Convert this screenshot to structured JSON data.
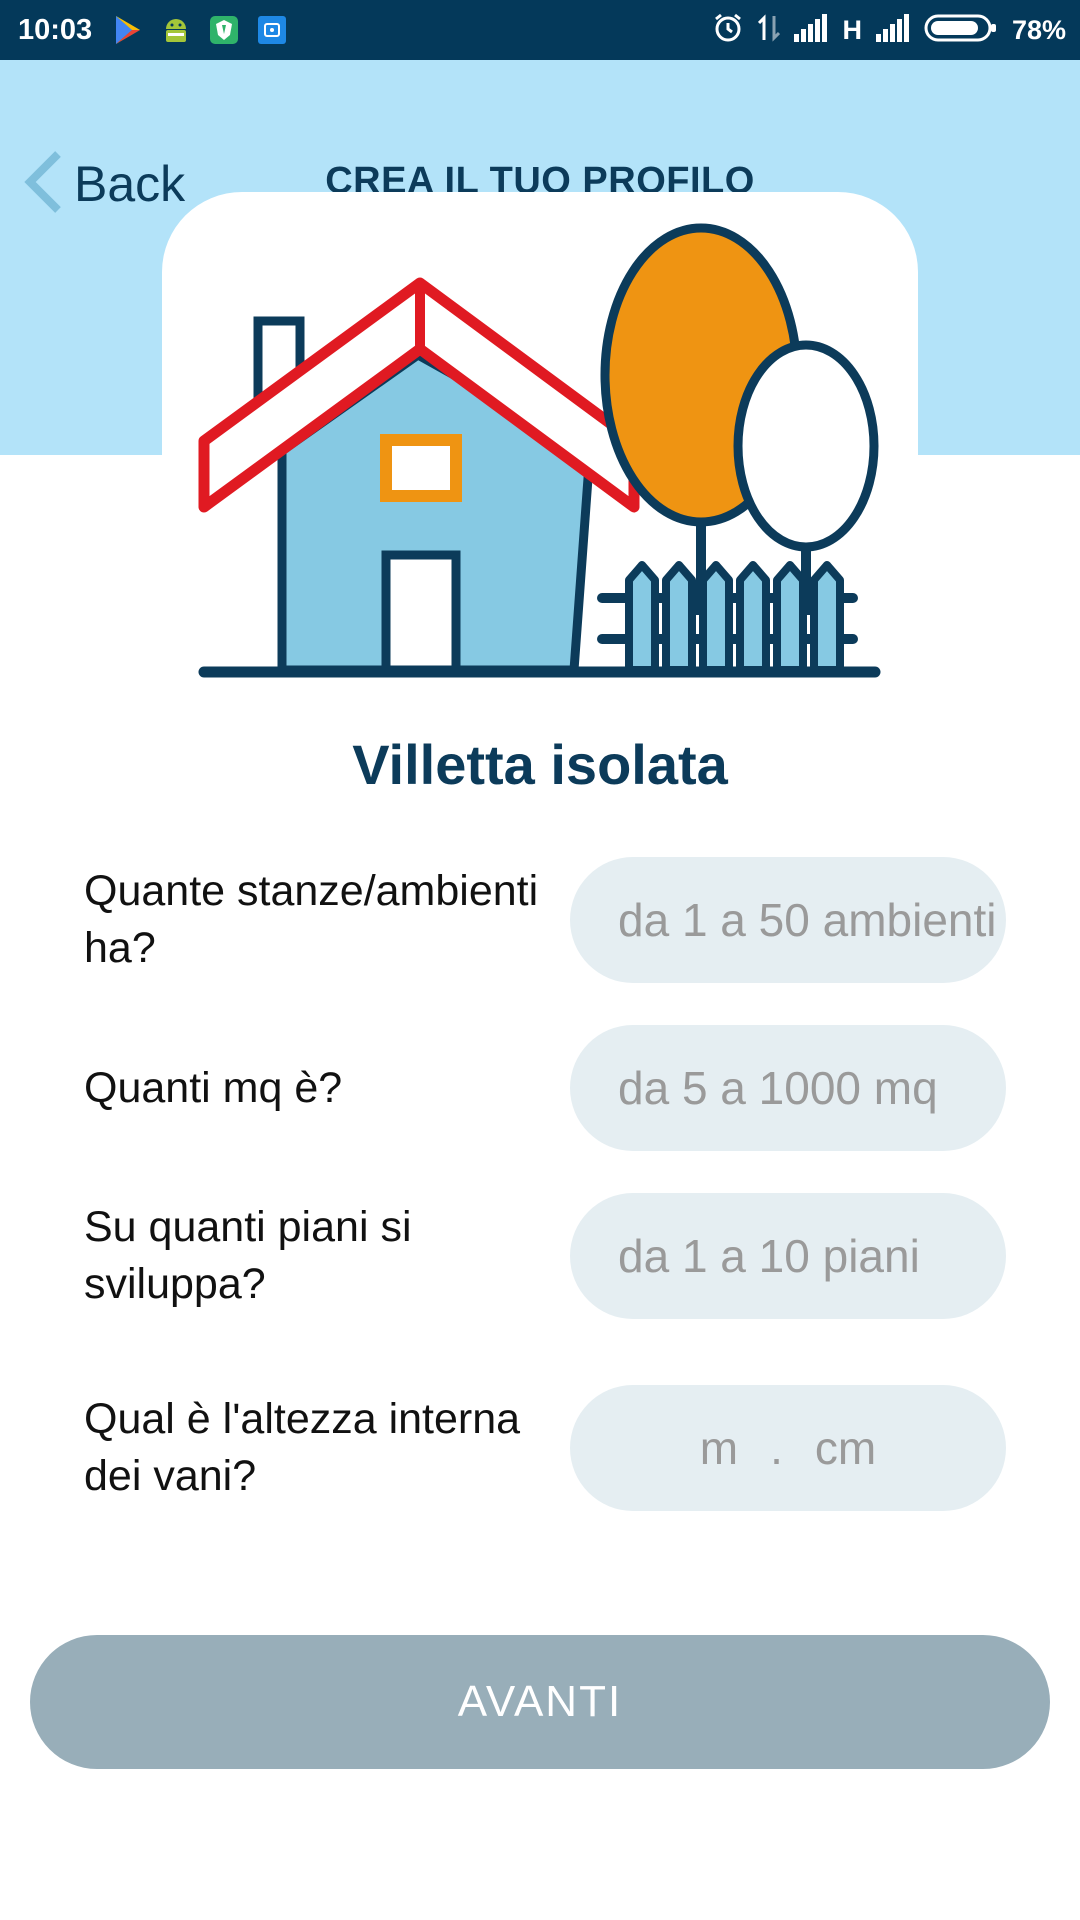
{
  "status_bar": {
    "time": "10:03",
    "network": "H",
    "battery": "78%"
  },
  "header": {
    "back_label": "Back",
    "title": "CREA IL TUO PROFILO"
  },
  "illustration": {
    "icon": "detached-house-with-trees-icon"
  },
  "form": {
    "house_type": "Villetta isolata",
    "rooms": {
      "label": "Quante stanze/ambienti ha?",
      "placeholder": "da 1 a 50 ambienti"
    },
    "area": {
      "label": "Quanti mq è?",
      "placeholder": "da 5 a 1000 mq"
    },
    "floors": {
      "label": "Su quanti piani si sviluppa?",
      "placeholder": "da 1 a 10 piani"
    },
    "height": {
      "label": "Qual è l'altezza interna dei vani?",
      "meters_placeholder": "m",
      "separator": ".",
      "cm_placeholder": "cm"
    }
  },
  "actions": {
    "next_label": "AVANTI"
  },
  "colors": {
    "status_bar": "#04395a",
    "header_bg": "#b3e3f9",
    "primary_text": "#0c3b5a",
    "input_bg": "#e5eef2",
    "button_disabled": "#98aeb9",
    "roof_red": "#e01a22",
    "house_blue": "#86c9e3",
    "tree_orange": "#ef9412"
  }
}
